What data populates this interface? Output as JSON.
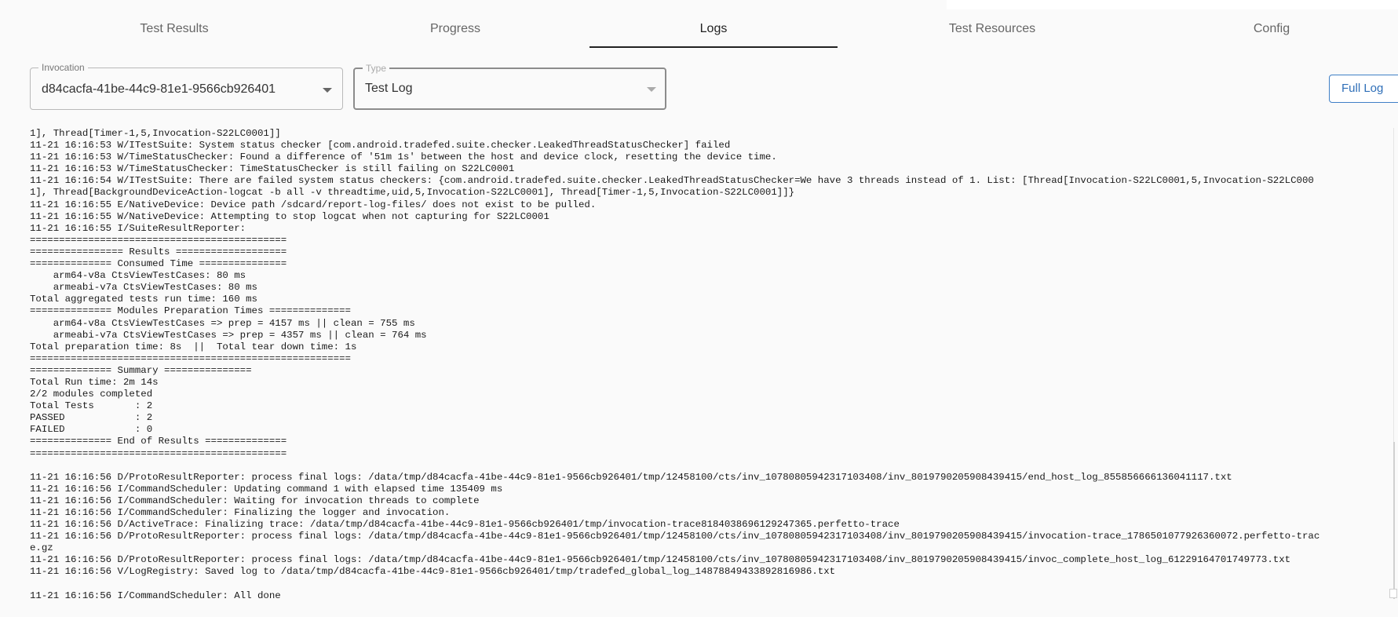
{
  "tabs": [
    {
      "label": "Test Results"
    },
    {
      "label": "Progress"
    },
    {
      "label": "Logs"
    },
    {
      "label": "Test Resources"
    },
    {
      "label": "Config"
    }
  ],
  "active_tab": "Logs",
  "filters": {
    "invocation": {
      "label": "Invocation",
      "value": "d84cacfa-41be-44c9-81e1-9566cb926401"
    },
    "type": {
      "label": "Type",
      "value": "Test Log"
    }
  },
  "full_log_label": "Full Log",
  "log_text": "1], Thread[Timer-1,5,Invocation-S22LC0001]]\n11-21 16:16:53 W/ITestSuite: System status checker [com.android.tradefed.suite.checker.LeakedThreadStatusChecker] failed\n11-21 16:16:53 W/TimeStatusChecker: Found a difference of '51m 1s' between the host and device clock, resetting the device time.\n11-21 16:16:53 W/TimeStatusChecker: TimeStatusChecker is still failing on S22LC0001\n11-21 16:16:54 W/ITestSuite: There are failed system status checkers: {com.android.tradefed.suite.checker.LeakedThreadStatusChecker=We have 3 threads instead of 1. List: [Thread[Invocation-S22LC0001,5,Invocation-S22LC000\n1], Thread[BackgroundDeviceAction-logcat -b all -v threadtime,uid,5,Invocation-S22LC0001], Thread[Timer-1,5,Invocation-S22LC0001]]}\n11-21 16:16:55 E/NativeDevice: Device path /sdcard/report-log-files/ does not exist to be pulled.\n11-21 16:16:55 W/NativeDevice: Attempting to stop logcat when not capturing for S22LC0001\n11-21 16:16:55 I/SuiteResultReporter:\n============================================\n================ Results ===================\n============== Consumed Time ===============\n    arm64-v8a CtsViewTestCases: 80 ms\n    armeabi-v7a CtsViewTestCases: 80 ms\nTotal aggregated tests run time: 160 ms\n============== Modules Preparation Times ==============\n    arm64-v8a CtsViewTestCases => prep = 4157 ms || clean = 755 ms\n    armeabi-v7a CtsViewTestCases => prep = 4357 ms || clean = 764 ms\nTotal preparation time: 8s  ||  Total tear down time: 1s\n=======================================================\n============== Summary ===============\nTotal Run time: 2m 14s\n2/2 modules completed\nTotal Tests       : 2\nPASSED            : 2\nFAILED            : 0\n============== End of Results ==============\n============================================\n\n11-21 16:16:56 D/ProtoResultReporter: process final logs: /data/tmp/d84cacfa-41be-44c9-81e1-9566cb926401/tmp/12458100/cts/inv_10780805942317103408/inv_8019790205908439415/end_host_log_855856666136041117.txt\n11-21 16:16:56 I/CommandScheduler: Updating command 1 with elapsed time 135409 ms\n11-21 16:16:56 I/CommandScheduler: Waiting for invocation threads to complete\n11-21 16:16:56 I/CommandScheduler: Finalizing the logger and invocation.\n11-21 16:16:56 D/ActiveTrace: Finalizing trace: /data/tmp/d84cacfa-41be-44c9-81e1-9566cb926401/tmp/invocation-trace8184038696129247365.perfetto-trace\n11-21 16:16:56 D/ProtoResultReporter: process final logs: /data/tmp/d84cacfa-41be-44c9-81e1-9566cb926401/tmp/12458100/cts/inv_10780805942317103408/inv_8019790205908439415/invocation-trace_1786501077926360072.perfetto-trac\ne.gz\n11-21 16:16:56 D/ProtoResultReporter: process final logs: /data/tmp/d84cacfa-41be-44c9-81e1-9566cb926401/tmp/12458100/cts/inv_10780805942317103408/inv_8019790205908439415/invoc_complete_host_log_61229164701749773.txt\n11-21 16:16:56 V/LogRegistry: Saved log to /data/tmp/d84cacfa-41be-44c9-81e1-9566cb926401/tmp/tradefed_global_log_14878849433892816986.txt\n\n11-21 16:16:56 I/CommandScheduler: All done"
}
